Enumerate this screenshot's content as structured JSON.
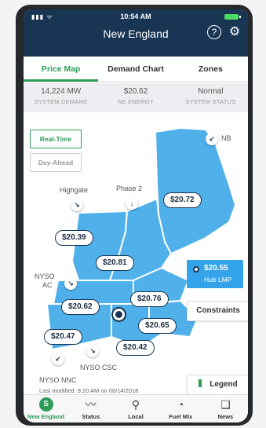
{
  "status_bar": {
    "time": "10:54 AM",
    "signal": "▮▮▮ ᯤ"
  },
  "header": {
    "title": "New England",
    "help_icon": "help-icon",
    "settings_icon": "gear-icon"
  },
  "tabs": [
    {
      "label": "Price Map",
      "active": true
    },
    {
      "label": "Demand Chart",
      "active": false
    },
    {
      "label": "Zones",
      "active": false
    }
  ],
  "stats": [
    {
      "value": "14,224 MW",
      "label": "SYSTEM DEMAND"
    },
    {
      "value": "$20.62",
      "label": "NE ENERGY"
    },
    {
      "value": "Normal",
      "label": "SYSTEM STATUS"
    }
  ],
  "map": {
    "realtime_label": "Real-Time",
    "dayahead_label": "Day-Ahead",
    "prices": {
      "maine": "$20.72",
      "vermont": "$20.39",
      "nh": "$20.81",
      "west_mass": "$20.62",
      "central_mass": "$20.76",
      "se_mass": "$20.65",
      "connecticut": "$20.47",
      "rhode_island": "$20.42"
    },
    "interfaces": {
      "nb": "NB",
      "highgate": "Highgate",
      "phase2": "Phase 2",
      "nyso_ac": "NYSO\nAC",
      "nyso_csc": "NYSO CSC",
      "nyso_nnc": "NYSO NNC"
    },
    "hub": {
      "value": "$20.55",
      "label": "Hub LMP"
    },
    "constraints_label": "Constraints",
    "legend_label": "Legend",
    "last_modified": "Last modified: 9:20 AM on 06/14/2018",
    "land_color": "#4fb0ea"
  },
  "nav": [
    {
      "label": "New England",
      "icon": "S",
      "active": true
    },
    {
      "label": "Status",
      "icon": "〰",
      "active": false
    },
    {
      "label": "Local",
      "icon": "⚲",
      "active": false
    },
    {
      "label": "Fuel Mix",
      "icon": "◔",
      "active": false
    },
    {
      "label": "News",
      "icon": "❏",
      "active": false
    }
  ]
}
